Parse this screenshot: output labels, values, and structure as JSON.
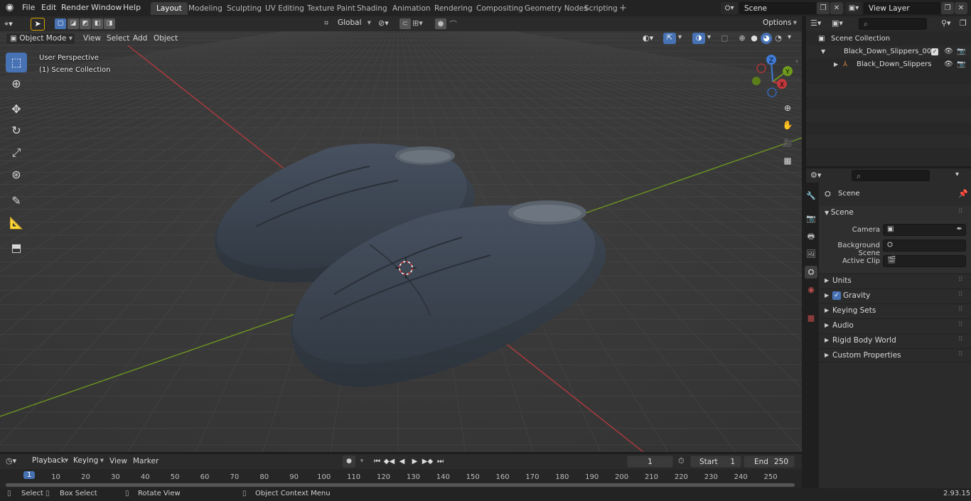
{
  "topbar": {
    "menus": [
      "File",
      "Edit",
      "Render",
      "Window",
      "Help"
    ],
    "workspaces": [
      "Layout",
      "Modeling",
      "Sculpting",
      "UV Editing",
      "Texture Paint",
      "Shading",
      "Animation",
      "Rendering",
      "Compositing",
      "Geometry Nodes",
      "Scripting"
    ],
    "active_workspace": "Layout",
    "scene_name": "Scene",
    "view_layer_name": "View Layer",
    "add_tab_glyph": "+"
  },
  "viewport_header": {
    "mode": "Object Mode",
    "menus": [
      "View",
      "Select",
      "Add",
      "Object"
    ],
    "orientation": "Global",
    "options_label": "Options"
  },
  "viewport": {
    "perspective": "User Perspective",
    "collection": "(1) Scene Collection",
    "gizmo": {
      "x": "X",
      "y": "Y",
      "z": "Z"
    },
    "colors": {
      "x_axis": "#c3383c",
      "y_axis": "#6f9a1e",
      "z_axis": "#3f7bd6",
      "grid": "#454545",
      "background": "#3a3a3a",
      "mesh": "#3b434c"
    }
  },
  "outliner": {
    "search_placeholder": "",
    "rows": [
      {
        "label": "Scene Collection",
        "level": 0
      },
      {
        "label": "Black_Down_Slippers_001",
        "level": 1
      },
      {
        "label": "Black_Down_Slippers",
        "level": 2
      }
    ]
  },
  "properties": {
    "context": "Scene",
    "section_title": "Scene",
    "fields": [
      {
        "label": "Camera"
      },
      {
        "label": "Background Scene"
      },
      {
        "label": "Active Clip"
      }
    ],
    "panels": [
      "Units",
      "Gravity",
      "Keying Sets",
      "Audio",
      "Rigid Body World",
      "Custom Properties"
    ],
    "gravity_checked": true
  },
  "timeline": {
    "menus": [
      "Playback",
      "Keying",
      "View",
      "Marker"
    ],
    "current_frame": "1",
    "start_label": "Start",
    "start": "1",
    "end_label": "End",
    "end": "250",
    "ticks": [
      "1",
      "10",
      "20",
      "30",
      "40",
      "50",
      "60",
      "70",
      "80",
      "90",
      "100",
      "110",
      "120",
      "130",
      "140",
      "150",
      "160",
      "170",
      "180",
      "190",
      "200",
      "210",
      "220",
      "230",
      "240",
      "250"
    ]
  },
  "statusbar": {
    "select": "Select",
    "box_select": "Box Select",
    "rotate_view": "Rotate View",
    "context_menu": "Object Context Menu",
    "version": "2.93.15"
  }
}
